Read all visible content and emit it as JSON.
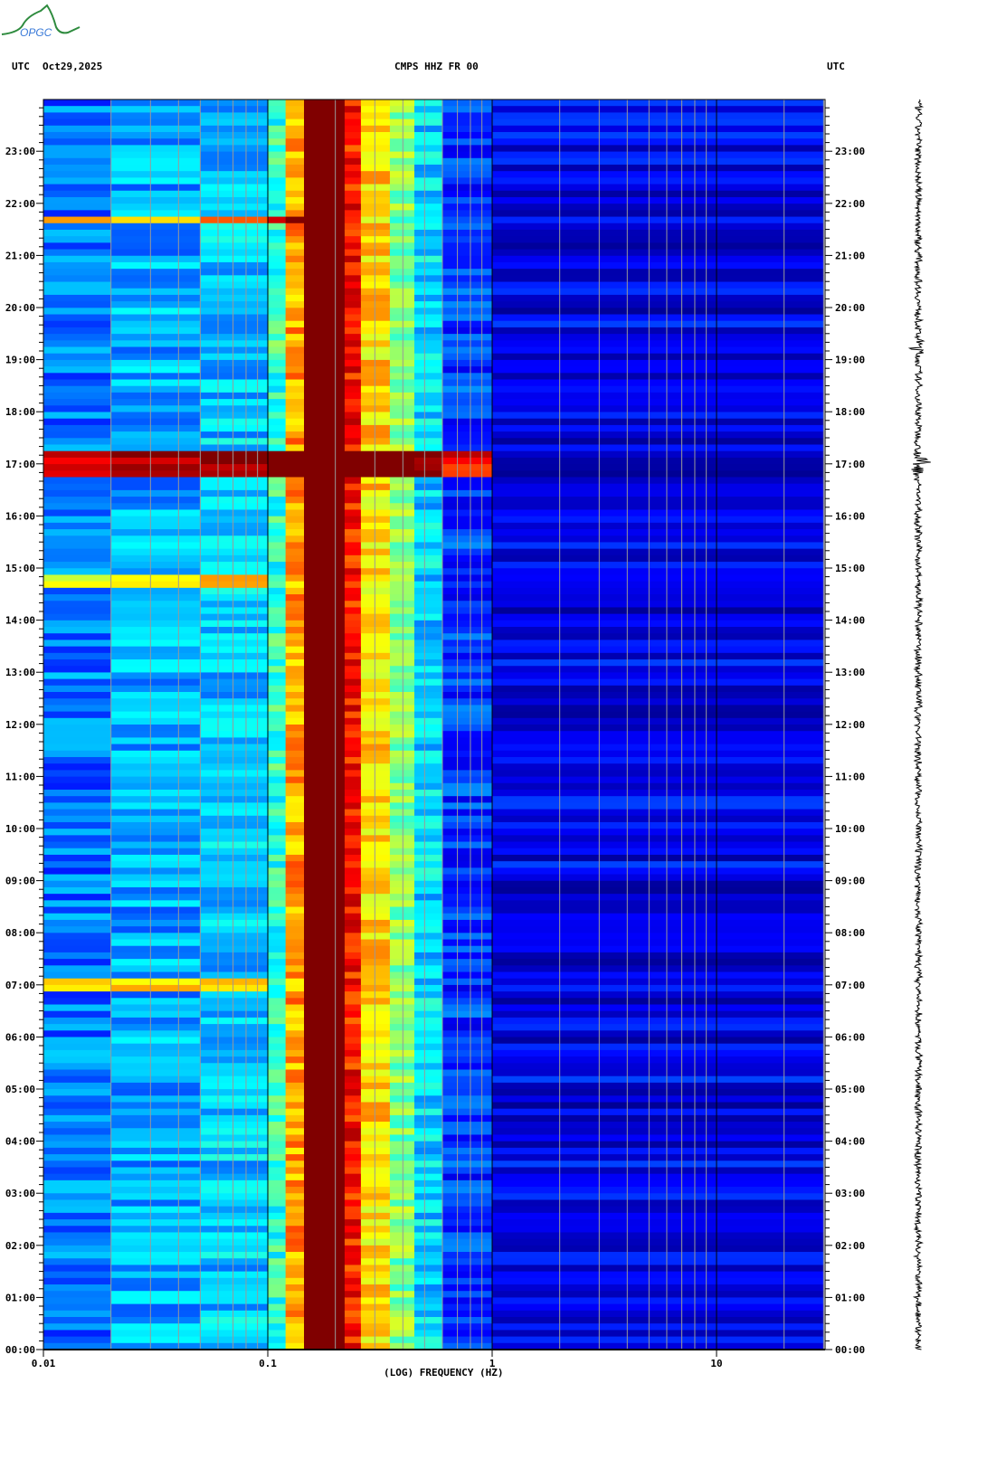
{
  "header": {
    "left_tz": "UTC",
    "date": "Oct29,2025",
    "station": "CMPS HHZ FR 00",
    "right_tz": "UTC",
    "logo_text": "OPGC"
  },
  "chart_data": {
    "type": "heatmap",
    "title": "CMPS HHZ FR 00",
    "xlabel": "(LOG) FREQUENCY (HZ)",
    "ylabel": "UTC",
    "xscale": "log",
    "xlim": [
      0.01,
      30
    ],
    "ylim_hours": [
      0,
      24
    ],
    "x_tick_labels": [
      "0.01",
      "0.1",
      "1",
      "10"
    ],
    "x_tick_values": [
      0.01,
      0.1,
      1,
      10
    ],
    "y_tick_labels": [
      "00:00",
      "01:00",
      "02:00",
      "03:00",
      "04:00",
      "05:00",
      "06:00",
      "07:00",
      "08:00",
      "09:00",
      "10:00",
      "11:00",
      "12:00",
      "13:00",
      "14:00",
      "15:00",
      "16:00",
      "17:00",
      "18:00",
      "19:00",
      "20:00",
      "21:00",
      "22:00",
      "23:00"
    ],
    "colormap": [
      "#00008b",
      "#0000ff",
      "#0080ff",
      "#00ffff",
      "#80ff80",
      "#ffff00",
      "#ff8000",
      "#ff0000",
      "#800000"
    ],
    "power_profile": [
      {
        "fmin": 0.01,
        "fmax": 0.02,
        "level": 0.24
      },
      {
        "fmin": 0.02,
        "fmax": 0.05,
        "level": 0.29
      },
      {
        "fmin": 0.05,
        "fmax": 0.1,
        "level": 0.32
      },
      {
        "fmin": 0.1,
        "fmax": 0.12,
        "level": 0.42
      },
      {
        "fmin": 0.12,
        "fmax": 0.145,
        "level": 0.72
      },
      {
        "fmin": 0.145,
        "fmax": 0.22,
        "level": 1.0
      },
      {
        "fmin": 0.22,
        "fmax": 0.26,
        "level": 0.86
      },
      {
        "fmin": 0.26,
        "fmax": 0.35,
        "level": 0.66
      },
      {
        "fmin": 0.35,
        "fmax": 0.45,
        "level": 0.5
      },
      {
        "fmin": 0.45,
        "fmax": 0.6,
        "level": 0.34
      },
      {
        "fmin": 0.6,
        "fmax": 1.0,
        "level": 0.18
      },
      {
        "fmin": 1.0,
        "fmax": 30,
        "level": 0.1
      }
    ],
    "events": [
      {
        "hour": 16.95,
        "duration": 0.45,
        "fmax": 0.8,
        "boost": 0.7
      },
      {
        "hour": 21.7,
        "duration": 0.08,
        "fmax": 0.14,
        "boost": 0.45
      },
      {
        "hour": 14.75,
        "duration": 0.15,
        "fmax": 0.1,
        "boost": 0.35
      },
      {
        "hour": 7.0,
        "duration": 0.1,
        "fmax": 0.1,
        "boost": 0.4
      },
      {
        "hour": 19.3,
        "duration": 0.1,
        "fmax": 30,
        "boost": 0.05
      }
    ],
    "trace_bursts": [
      {
        "hour": 17.0,
        "amp": 1.0
      },
      {
        "hour": 19.25,
        "amp": 0.45
      }
    ]
  }
}
